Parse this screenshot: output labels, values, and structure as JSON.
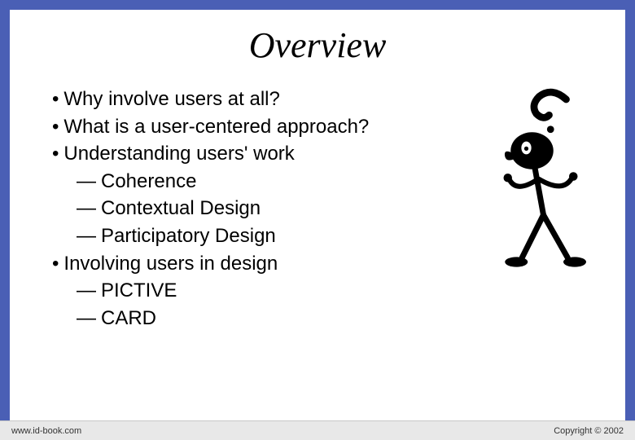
{
  "slide": {
    "title": "Overview",
    "bullets": {
      "b1_0": "Why involve users at all?",
      "b1_1": "What is a user-centered approach?",
      "b1_2": "Understanding users' work",
      "b2_0": "Coherence",
      "b2_1": "Contextual Design",
      "b2_2": "Participatory Design",
      "b1_3": "Involving users in design",
      "b2_3": "PICTIVE",
      "b2_4": "CARD"
    }
  },
  "footer": {
    "left": "www.id-book.com",
    "right": "Copyright © 2002"
  },
  "figure": {
    "name": "thinking-person-question-mark-icon"
  },
  "colors": {
    "border": "#4a5fb5",
    "slide_bg": "#ffffff",
    "text": "#000000",
    "footer_bg": "#e8e8e8"
  }
}
